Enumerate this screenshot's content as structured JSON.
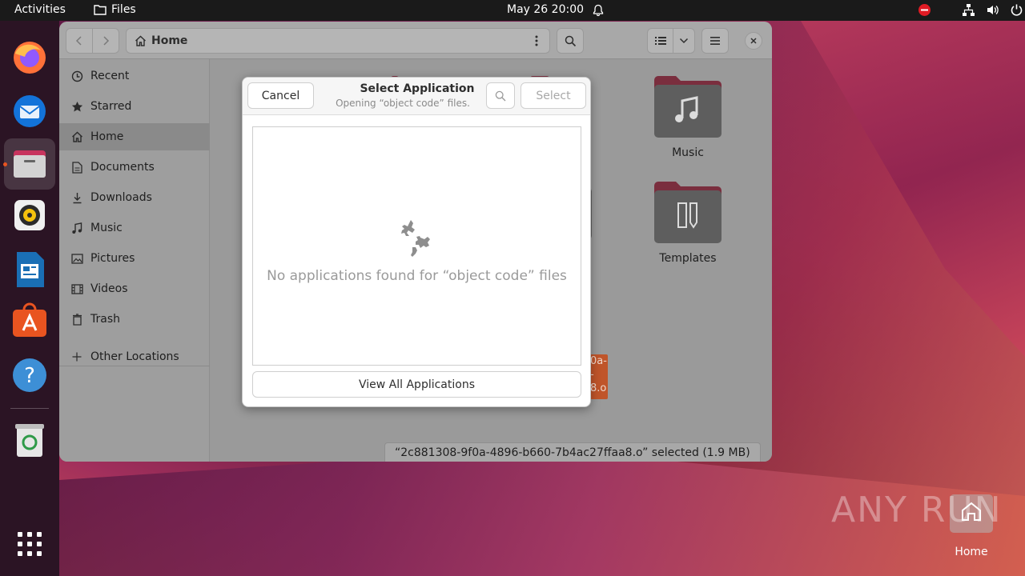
{
  "topbar": {
    "activities": "Activities",
    "app_name": "Files",
    "clock": "May 26  20:00"
  },
  "dock": {
    "items": [
      {
        "name": "Firefox",
        "icon": "firefox-icon"
      },
      {
        "name": "Thunderbird",
        "icon": "thunderbird-icon"
      },
      {
        "name": "Files",
        "icon": "files-icon"
      },
      {
        "name": "Rhythmbox",
        "icon": "rhythmbox-icon"
      },
      {
        "name": "LibreOffice Writer",
        "icon": "writer-icon"
      },
      {
        "name": "Ubuntu Software",
        "icon": "software-icon"
      },
      {
        "name": "Help",
        "icon": "help-icon"
      },
      {
        "name": "Trash",
        "icon": "trash-icon"
      },
      {
        "name": "Show Applications",
        "icon": "app-grid-icon"
      }
    ]
  },
  "files": {
    "location": "Home",
    "sidebar": [
      {
        "label": "Recent",
        "icon": "clock-icon"
      },
      {
        "label": "Starred",
        "icon": "star-icon"
      },
      {
        "label": "Home",
        "icon": "home-icon"
      },
      {
        "label": "Documents",
        "icon": "document-icon"
      },
      {
        "label": "Downloads",
        "icon": "download-icon"
      },
      {
        "label": "Music",
        "icon": "music-icon"
      },
      {
        "label": "Pictures",
        "icon": "picture-icon"
      },
      {
        "label": "Videos",
        "icon": "video-icon"
      },
      {
        "label": "Trash",
        "icon": "trash-icon"
      },
      {
        "label": "Other Locations",
        "icon": "plus-icon"
      }
    ],
    "folders": [
      {
        "label": "Music"
      },
      {
        "label": "Templates"
      }
    ],
    "partial_file_label": "0a-\n-\n8.o",
    "status": "“2c881308-9f0a-4896-b660-7b4ac27ffaa8.o” selected  (1.9 MB)"
  },
  "dialog": {
    "title": "Select Application",
    "subtitle": "Opening “object code” files.",
    "cancel_label": "Cancel",
    "select_label": "Select",
    "empty_message": "No applications found for “object code” files",
    "view_all_label": "View All Applications"
  },
  "desktop": {
    "home_label": "Home",
    "watermark": "ANY RUN"
  },
  "colors": {
    "accent": "#e95420",
    "topbar": "#1a1a1a",
    "dock": "#2b1424"
  }
}
